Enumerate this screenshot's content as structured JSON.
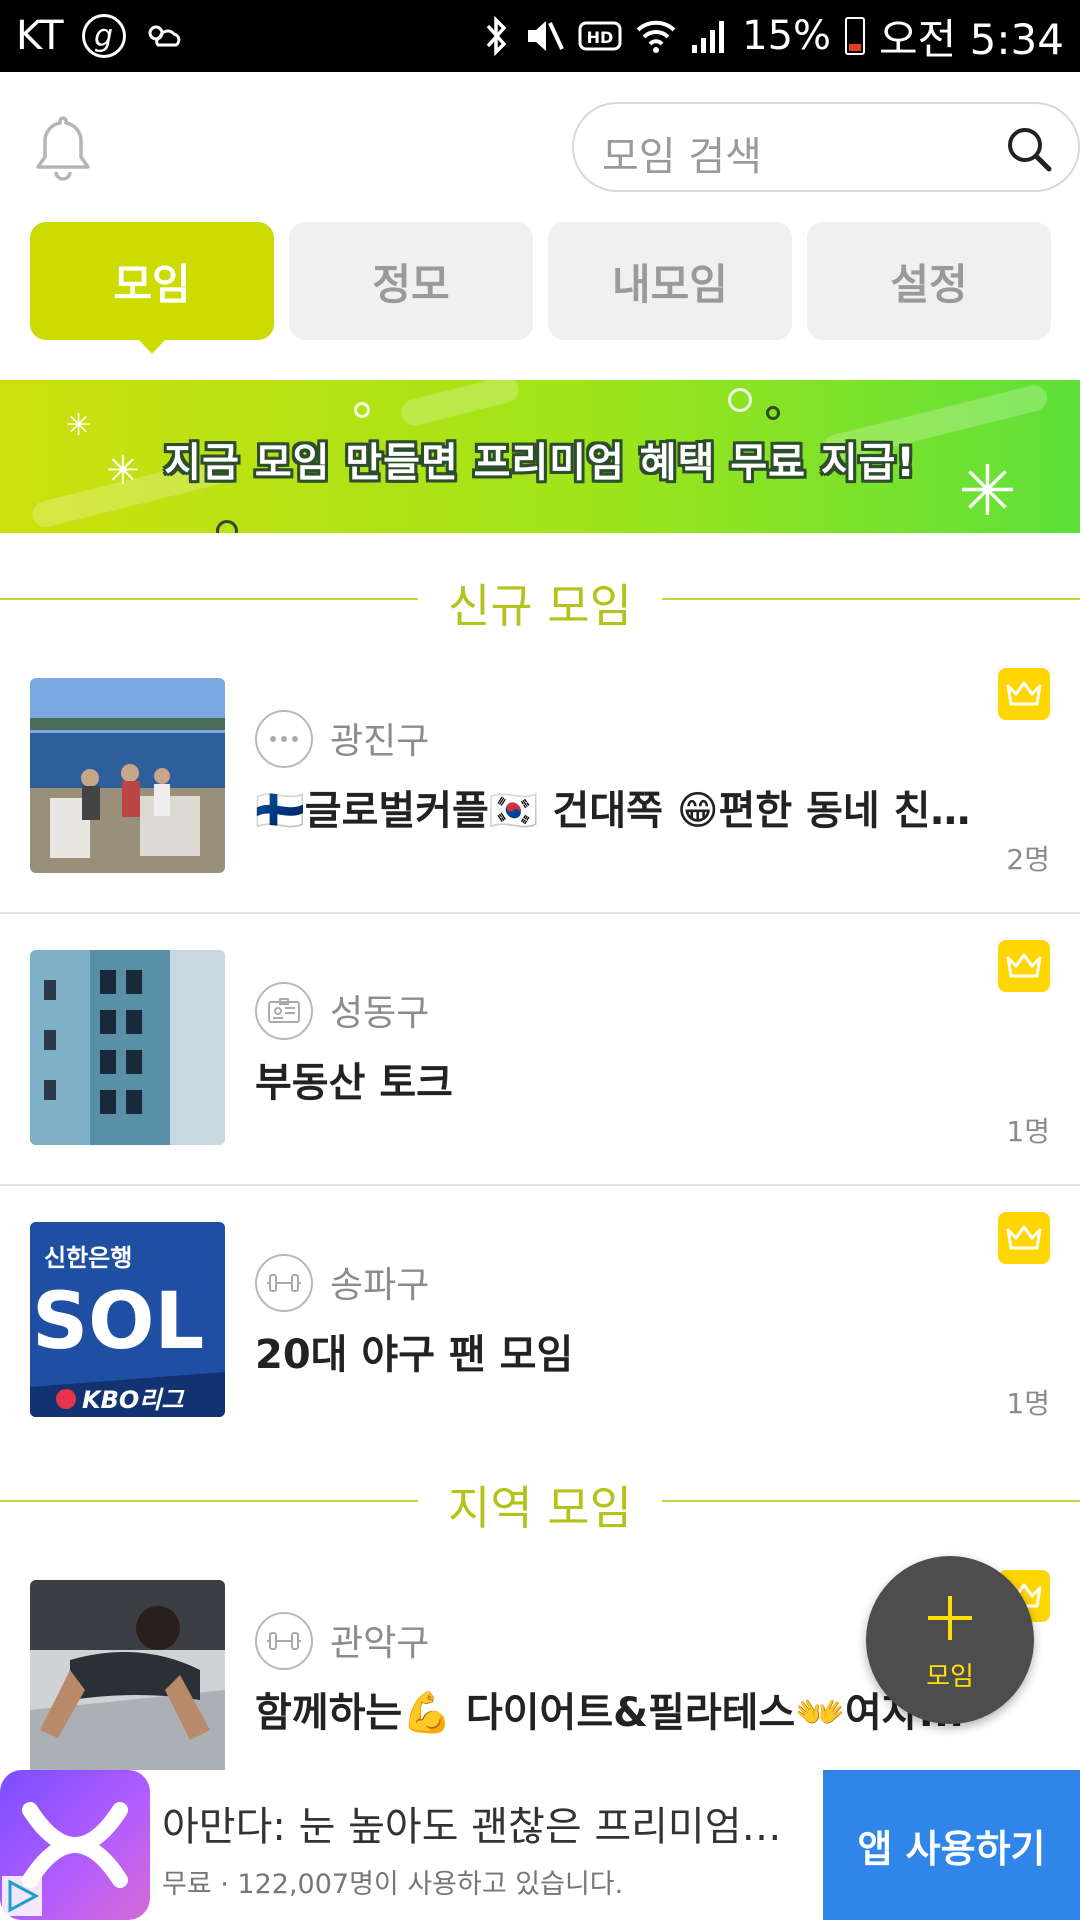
{
  "status_bar": {
    "carrier": "KT",
    "battery": "15%",
    "time": "오전 5:34"
  },
  "search": {
    "placeholder": "모임 검색"
  },
  "tabs": [
    {
      "label": "모임",
      "active": true
    },
    {
      "label": "정모",
      "active": false
    },
    {
      "label": "내모임",
      "active": false
    },
    {
      "label": "설정",
      "active": false
    }
  ],
  "banner": {
    "text": "지금 모임 만들면 프리미엄 혜택 무료 지급!"
  },
  "sections": {
    "new": {
      "title": "신규 모임"
    },
    "local": {
      "title": "지역 모임"
    }
  },
  "groups": [
    {
      "district": "광진구",
      "name": "🇫🇮글로벌커플🇰🇷 건대쪽 😁편한 동네 친...",
      "members": "2명",
      "category_icon": "more-icon"
    },
    {
      "district": "성동구",
      "name": "부동산 토크",
      "members": "1명",
      "category_icon": "id-card-icon"
    },
    {
      "district": "송파구",
      "name": "20대 야구 팬 모임",
      "members": "1명",
      "category_icon": "dumbbell-icon"
    },
    {
      "district": "관악구",
      "name": "함께하는💪 다이어트&필라테스👐여자...",
      "members": "",
      "category_icon": "dumbbell-icon"
    }
  ],
  "thumbnail_text": {
    "bank": "신한은행",
    "sol": "SOL",
    "kbo": "KBO리그"
  },
  "fab": {
    "label": "모임"
  },
  "ad": {
    "title": "아만다: 눈 높아도 괜찮은 프리미엄 ...",
    "subtitle": "무료 · 122,007명이 사용하고 있습니다.",
    "button": "앱 사용하기"
  },
  "colors": {
    "accent": "#cddc00",
    "section_title": "#b5c21c",
    "crown": "#ffd600",
    "ad_button": "#2f86e8",
    "fab": "#4d4d4d"
  }
}
